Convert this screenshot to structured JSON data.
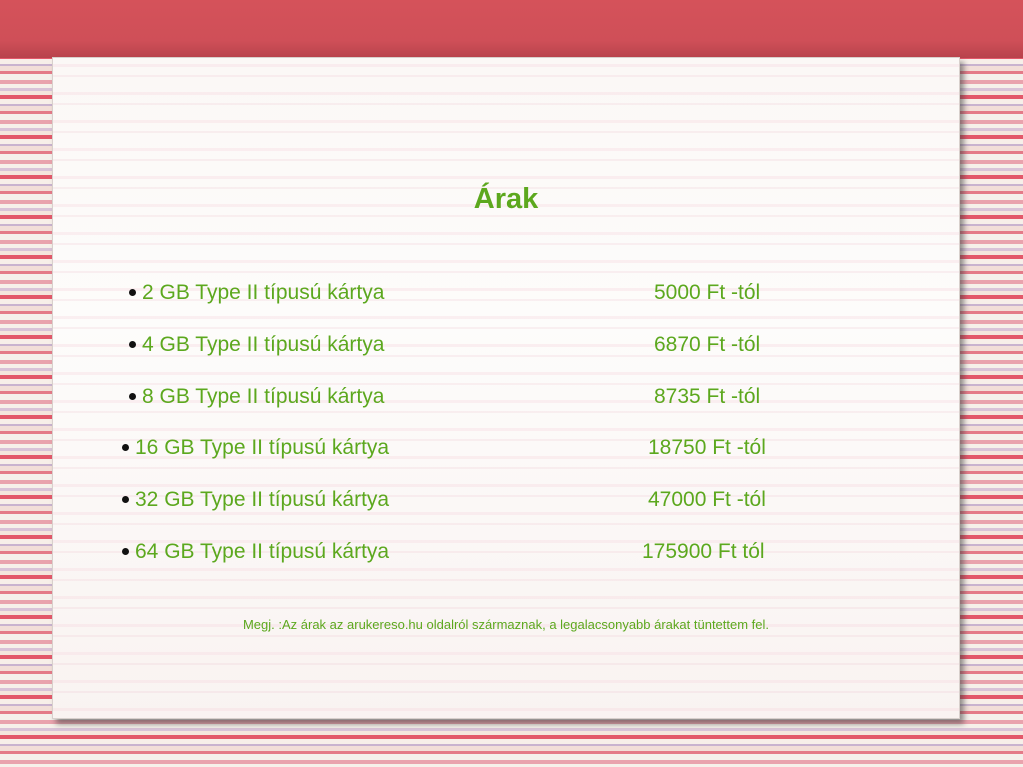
{
  "slide": {
    "title": "Árak",
    "items": [
      {
        "label": "2 GB Type II típusú kártya",
        "price": "5000 Ft -tól"
      },
      {
        "label": "4 GB Type II típusú kártya",
        "price": "6870 Ft -tól"
      },
      {
        "label": "8 GB Type II típusú kártya",
        "price": "8735 Ft -tól"
      },
      {
        "label": "16 GB Type II típusú kártya",
        "price": "18750 Ft -tól"
      },
      {
        "label": "32 GB Type II típusú kártya",
        "price": "47000 Ft -tól"
      },
      {
        "label": "64 GB Type II típusú kártya",
        "price": "175900 Ft tól"
      }
    ],
    "note": "Megj. :Az árak az arukereso.hu oldalról származnak, a legalacsonyabb árakat tüntettem fel."
  },
  "colors": {
    "text": "#5ca81e",
    "band": "#d5525a"
  }
}
